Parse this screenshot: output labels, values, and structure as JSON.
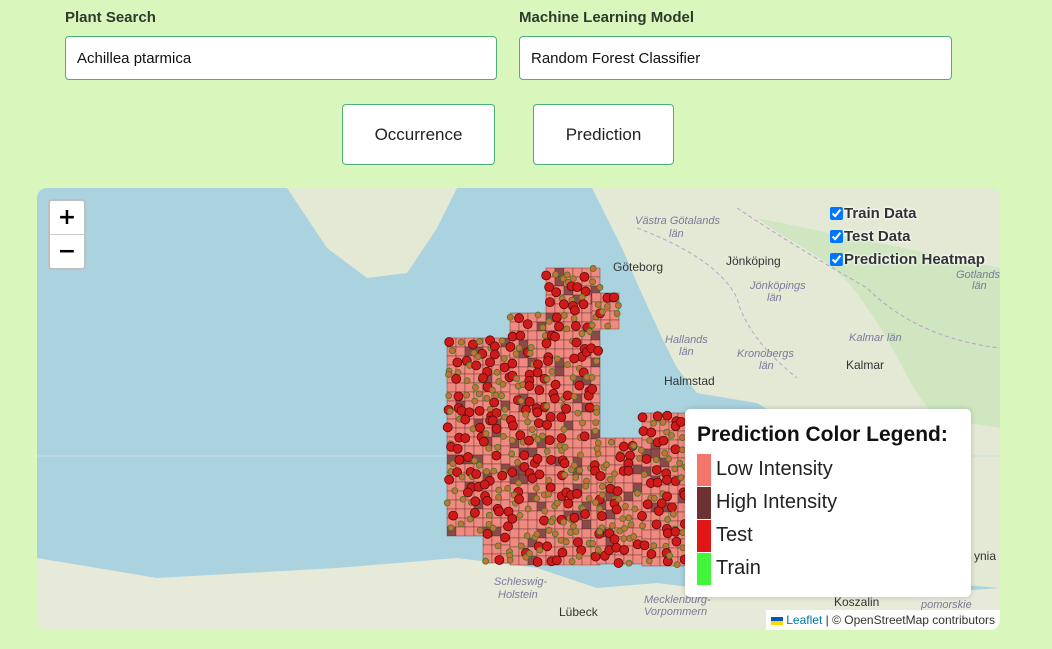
{
  "plant_search": {
    "label": "Plant Search",
    "value": "Achillea ptarmica"
  },
  "model": {
    "label": "Machine Learning Model",
    "value": "Random Forest Classifier"
  },
  "buttons": {
    "occurrence": "Occurrence",
    "prediction": "Prediction"
  },
  "map": {
    "zoom_in": "+",
    "zoom_out": "−",
    "layers": [
      {
        "label": "Train Data",
        "checked": true
      },
      {
        "label": "Test Data",
        "checked": true
      },
      {
        "label": "Prediction Heatmap",
        "checked": true
      }
    ],
    "legend": {
      "title": "Prediction Color Legend:",
      "items": [
        {
          "label": "Low Intensity",
          "color": "#f4756b"
        },
        {
          "label": "High Intensity",
          "color": "#6e3232"
        },
        {
          "label": "Test",
          "color": "#e01515"
        },
        {
          "label": "Train",
          "color": "#42f53b"
        }
      ]
    },
    "attribution": {
      "leaflet": "Leaflet",
      "rest": "| © OpenStreetMap contributors"
    },
    "place_labels": [
      "Västra Götalands län",
      "Göteborg",
      "Jönköping",
      "Jönköpings län",
      "Hallands län",
      "Kronobergs län",
      "Kalmar län",
      "Kalmar",
      "Halmstad",
      "Gotlands län",
      "Schleswig-Holstein",
      "Lübeck",
      "Mecklenburg-Vorpommern",
      "Koszalin",
      "pomorskie",
      "ynia"
    ]
  }
}
